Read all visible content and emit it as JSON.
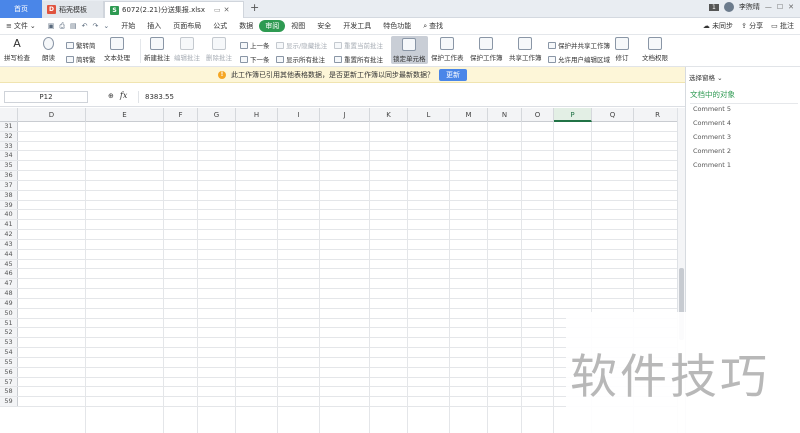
{
  "tabs": {
    "home": "首页",
    "template": "稻壳模板",
    "file": "6072(2.21)分送集报.xlsx",
    "add": "+",
    "badge": "1",
    "user": "李煦晴"
  },
  "menu": {
    "file": "文件",
    "items": [
      "开始",
      "插入",
      "页面布局",
      "公式",
      "数据",
      "审阅",
      "视图",
      "安全",
      "开发工具",
      "特色功能"
    ],
    "active": "审阅",
    "search": "查找",
    "sync": "未同步",
    "share": "分享",
    "annotate": "批注"
  },
  "toolbar": {
    "spell": "拼写检查",
    "read": "朗读",
    "trad": "繁转简",
    "simp": "简转繁",
    "textproc": "文本处理",
    "newcomment": "新建批注",
    "editcomment": "编辑批注",
    "delcomment": "删除批注",
    "prev": "上一条",
    "next": "下一条",
    "showhide": "显示/隐藏批注",
    "showall": "显示所有批注",
    "resetcur": "重置当前批注",
    "resetall": "重置所有批注",
    "lockcell": "锁定单元格",
    "protectsheet": "保护工作表",
    "protectbook": "保护工作簿",
    "sharebook": "共享工作簿",
    "protectshare": "保护并共享工作簿",
    "allowedit": "允许用户编辑区域",
    "revise": "修订",
    "docperm": "文档权限"
  },
  "notice": {
    "text": "此工作簿已引用其他表格数据，是否更新工作簿以同步最新数据？",
    "button": "更新"
  },
  "formula": {
    "cell": "P12",
    "fx": "fx",
    "value": "8383.55"
  },
  "grid": {
    "columns": [
      "D",
      "E",
      "F",
      "G",
      "H",
      "I",
      "J",
      "K",
      "L",
      "M",
      "N",
      "O",
      "P",
      "Q",
      "R"
    ],
    "selected_column": "P",
    "rows": [
      "31",
      "32",
      "33",
      "34",
      "35",
      "36",
      "37",
      "38",
      "39",
      "40",
      "41",
      "42",
      "43",
      "44",
      "45",
      "46",
      "47",
      "48",
      "49",
      "50",
      "51",
      "52",
      "53",
      "54",
      "55",
      "56",
      "57",
      "58",
      "59"
    ]
  },
  "pane": {
    "title": "选择窗格",
    "heading": "文档中的对象",
    "items": [
      "Comment 5",
      "Comment 4",
      "Comment 3",
      "Comment 2",
      "Comment 1"
    ]
  },
  "watermark": "软件技巧",
  "colors": {
    "accent": "#2e9a52",
    "tab_blue": "#4a86e8",
    "notice_bg": "#fdf6d8"
  }
}
